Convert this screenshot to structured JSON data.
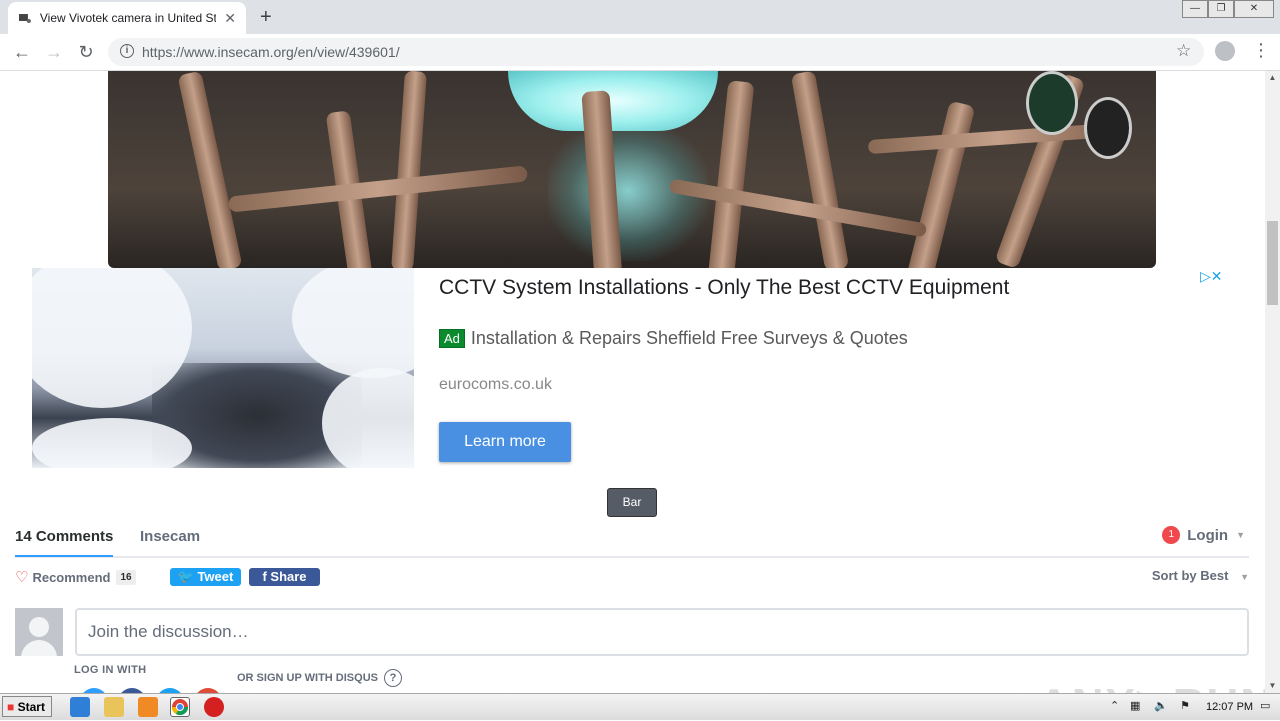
{
  "browser": {
    "tab_title": "View Vivotek camera in United States",
    "tab_close": "✕",
    "new_tab": "+",
    "url_host": "https://www.insecam.org",
    "url_path": "/en/view/439601/"
  },
  "ad": {
    "title": "CCTV System Installations - Only The Best CCTV Equipment",
    "badge": "Ad",
    "description": "Installation & Repairs Sheffield Free Surveys & Quotes",
    "domain": "eurocoms.co.uk",
    "cta": "Learn more",
    "choices": "▷✕"
  },
  "camera_tag": "Bar",
  "disqus": {
    "comments_tab": "14 Comments",
    "site_tab": "Insecam",
    "notif_count": "1",
    "login": "Login",
    "recommend": "Recommend",
    "recommend_count": "16",
    "tweet": "Tweet",
    "share": "Share",
    "sort": "Sort by Best",
    "composer_placeholder": "Join the discussion…",
    "login_with": "LOG IN WITH",
    "signup": "OR SIGN UP WITH DISQUS"
  },
  "watermark": "ANY▷RUN",
  "taskbar": {
    "start": "Start",
    "clock": "12:07 PM"
  },
  "colors": {
    "disqus_blue": "#2e9fff",
    "twitter": "#1da1f2",
    "facebook": "#3b5998",
    "ad_button": "#4a90e2"
  }
}
